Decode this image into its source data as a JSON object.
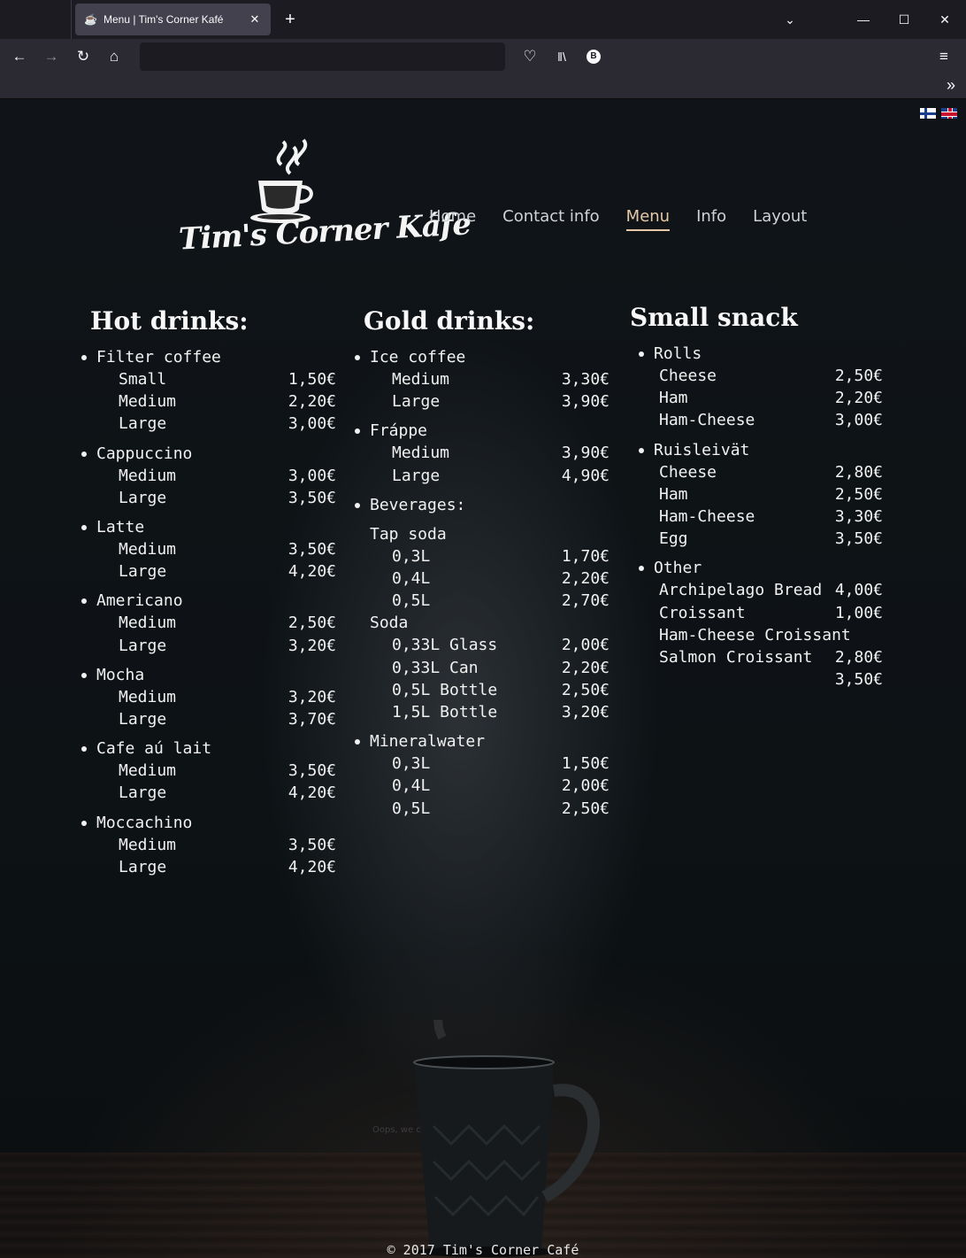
{
  "browser": {
    "tab_title": "Menu | Tim's Corner Kafé",
    "tab_close": "✕",
    "new_tab": "+",
    "favicon": "☕",
    "url": ""
  },
  "site": {
    "logo_text": "Tim's Corner Káfe",
    "nav": [
      "Home",
      "Contact info",
      "Menu",
      "Info",
      "Layout"
    ],
    "active_nav": "Menu",
    "footer": "© 2017 Tim's Corner Café",
    "faint_text": "Oops, we c"
  },
  "hot_drinks": {
    "title": "Hot drinks:",
    "groups": [
      {
        "name": "Filter coffee",
        "items": [
          {
            "size": "Small",
            "price": "1,50€"
          },
          {
            "size": "Medium",
            "price": "2,20€"
          },
          {
            "size": "Large",
            "price": "3,00€"
          }
        ]
      },
      {
        "name": "Cappuccino",
        "items": [
          {
            "size": "Medium",
            "price": "3,00€"
          },
          {
            "size": "Large",
            "price": "3,50€"
          }
        ]
      },
      {
        "name": "Latte",
        "items": [
          {
            "size": "Medium",
            "price": "3,50€"
          },
          {
            "size": "Large",
            "price": "4,20€"
          }
        ]
      },
      {
        "name": "Americano",
        "items": [
          {
            "size": "Medium",
            "price": "2,50€"
          },
          {
            "size": "Large",
            "price": "3,20€"
          }
        ]
      },
      {
        "name": "Mocha",
        "items": [
          {
            "size": "Medium",
            "price": "3,20€"
          },
          {
            "size": "Large",
            "price": "3,70€"
          }
        ]
      },
      {
        "name": "Cafe aú lait",
        "items": [
          {
            "size": "Medium",
            "price": "3,50€"
          },
          {
            "size": "Large",
            "price": "4,20€"
          }
        ]
      },
      {
        "name": "Moccachino",
        "items": [
          {
            "size": "Medium",
            "price": "3,50€"
          },
          {
            "size": "Large",
            "price": "4,20€"
          }
        ]
      }
    ]
  },
  "gold_drinks": {
    "title": "Gold drinks:",
    "ice_coffee": {
      "name": "Ice coffee",
      "items": [
        {
          "size": "Medium",
          "price": "3,30€"
        },
        {
          "size": "Large",
          "price": "3,90€"
        }
      ]
    },
    "frappe": {
      "name": "Fráppe",
      "items": [
        {
          "size": "Medium",
          "price": "3,90€"
        },
        {
          "size": "Large",
          "price": "4,90€"
        }
      ]
    },
    "beverages": "Beverages:",
    "tap_soda": {
      "name": "Tap soda",
      "items": [
        {
          "size": "0,3L",
          "price": "1,70€"
        },
        {
          "size": "0,4L",
          "price": "2,20€"
        },
        {
          "size": "0,5L",
          "price": "2,70€"
        }
      ]
    },
    "soda": {
      "name": "Soda",
      "items": [
        {
          "size": "0,33L Glass",
          "price": "2,00€"
        },
        {
          "size": "0,33L Can",
          "price": "2,20€"
        },
        {
          "size": "0,5L Bottle",
          "price": "2,50€"
        },
        {
          "size": "1,5L Bottle",
          "price": "3,20€"
        }
      ]
    },
    "mineralwater": {
      "name": "Mineralwater",
      "items": [
        {
          "size": "0,3L",
          "price": "1,50€"
        },
        {
          "size": "0,4L",
          "price": "2,00€"
        },
        {
          "size": "0,5L",
          "price": "2,50€"
        }
      ]
    }
  },
  "small_snack": {
    "title": "Small snack",
    "rolls": {
      "name": "Rolls",
      "items": [
        {
          "size": "Cheese",
          "price": "2,50€"
        },
        {
          "size": "Ham",
          "price": "2,20€"
        },
        {
          "size": "Ham-Cheese",
          "price": "3,00€"
        }
      ]
    },
    "ruisleivat": {
      "name": "Ruisleivät",
      "items": [
        {
          "size": "Cheese",
          "price": "2,80€"
        },
        {
          "size": "Ham",
          "price": "2,50€"
        },
        {
          "size": "Ham-Cheese",
          "price": "3,30€"
        },
        {
          "size": "Egg",
          "price": "3,50€"
        }
      ]
    },
    "other": {
      "name": "Other",
      "rows": [
        {
          "name": "Archipelago Bread",
          "price": "4,00€"
        },
        {
          "name": "Croissant",
          "price": "1,00€"
        },
        {
          "name": "Ham-Cheese Croissant",
          "price": ""
        },
        {
          "name": "Salmon Croissant",
          "price": "2,80€"
        },
        {
          "name": "",
          "price": "3,50€"
        }
      ]
    }
  }
}
